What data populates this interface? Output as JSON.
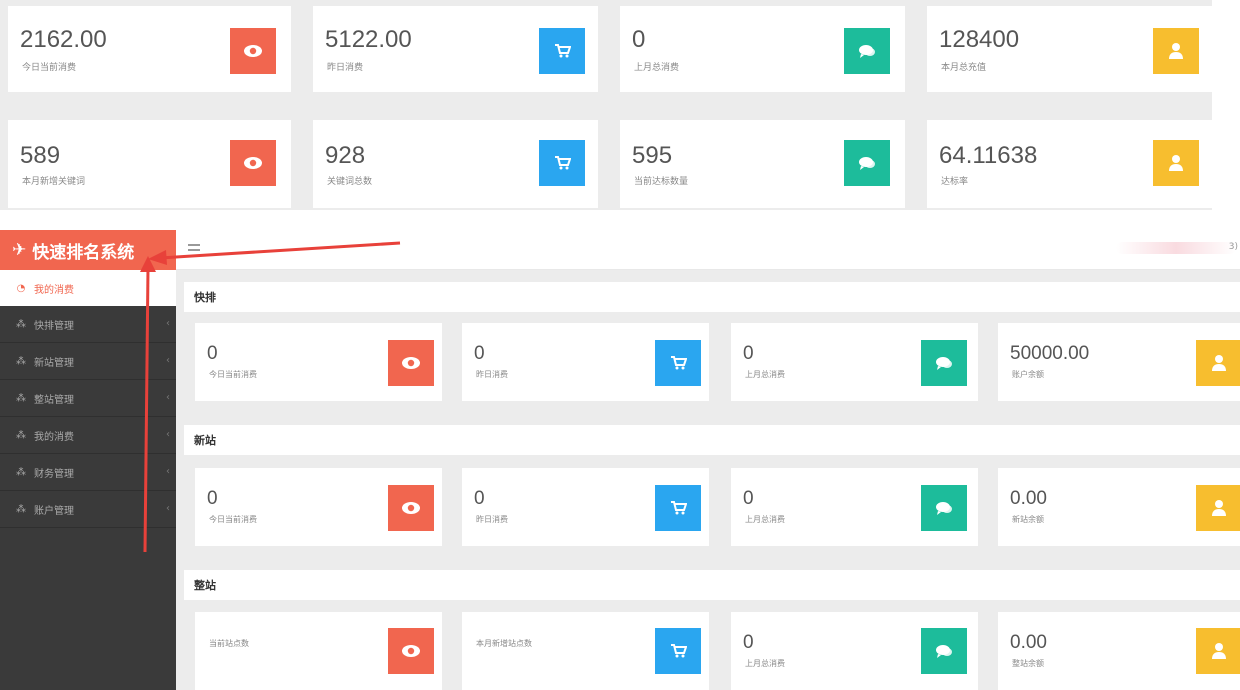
{
  "top_stats": [
    {
      "value": "2162.00",
      "label": "今日当前消费",
      "icon": "eye-icon",
      "color": "#f1664f"
    },
    {
      "value": "5122.00",
      "label": "昨日消费",
      "icon": "cart-icon",
      "color": "#2aa6f0"
    },
    {
      "value": "0",
      "label": "上月总消费",
      "icon": "chat-icon",
      "color": "#1dbc9b"
    },
    {
      "value": "128400",
      "label": "本月总充值",
      "icon": "user-icon",
      "color": "#f7be2f"
    },
    {
      "value": "589",
      "label": "本月新增关键词",
      "icon": "eye-icon",
      "color": "#f1664f"
    },
    {
      "value": "928",
      "label": "关键词总数",
      "icon": "cart-icon",
      "color": "#2aa6f0"
    },
    {
      "value": "595",
      "label": "当前达标数量",
      "icon": "chat-icon",
      "color": "#1dbc9b"
    },
    {
      "value": "64.11638",
      "label": "达标率",
      "icon": "user-icon",
      "color": "#f7be2f"
    }
  ],
  "brand": {
    "title": "快速排名系统",
    "icon": "plane-icon"
  },
  "topbar": {
    "tail_text": "3)"
  },
  "sidebar": {
    "active": {
      "label": "我的消费",
      "icon": "dashboard-icon"
    },
    "items": [
      {
        "label": "快排管理",
        "icon": "sitemap-icon"
      },
      {
        "label": "新站管理",
        "icon": "sitemap-icon"
      },
      {
        "label": "整站管理",
        "icon": "sitemap-icon"
      },
      {
        "label": "我的消费",
        "icon": "sitemap-icon"
      },
      {
        "label": "财务管理",
        "icon": "sitemap-icon"
      },
      {
        "label": "账户管理",
        "icon": "sitemap-icon"
      }
    ],
    "chevron": "‹"
  },
  "sections": [
    {
      "title": "快排",
      "cards": [
        {
          "value": "0",
          "label": "今日当前消费",
          "icon": "eye-icon"
        },
        {
          "value": "0",
          "label": "昨日消费",
          "icon": "cart-icon"
        },
        {
          "value": "0",
          "label": "上月总消费",
          "icon": "chat-icon"
        },
        {
          "value": "50000.00",
          "label": "账户余额",
          "icon": "user-icon"
        }
      ]
    },
    {
      "title": "新站",
      "cards": [
        {
          "value": "0",
          "label": "今日当前消费",
          "icon": "eye-icon"
        },
        {
          "value": "0",
          "label": "昨日消费",
          "icon": "cart-icon"
        },
        {
          "value": "0",
          "label": "上月总消费",
          "icon": "chat-icon"
        },
        {
          "value": "0.00",
          "label": "新站余额",
          "icon": "user-icon"
        }
      ]
    },
    {
      "title": "整站",
      "cards": [
        {
          "value": "",
          "label": "当前站点数",
          "icon": "eye-icon"
        },
        {
          "value": "",
          "label": "本月新增站点数",
          "icon": "cart-icon"
        },
        {
          "value": "0",
          "label": "上月总消费",
          "icon": "chat-icon"
        },
        {
          "value": "0.00",
          "label": "整站余额",
          "icon": "user-icon"
        }
      ]
    }
  ],
  "colors": {
    "red": "#f1664f",
    "blue": "#2aa6f0",
    "green": "#1dbc9b",
    "yellow": "#f7be2f",
    "sidebar": "#3a3a3a",
    "annotation_arrow": "#e8413a"
  }
}
